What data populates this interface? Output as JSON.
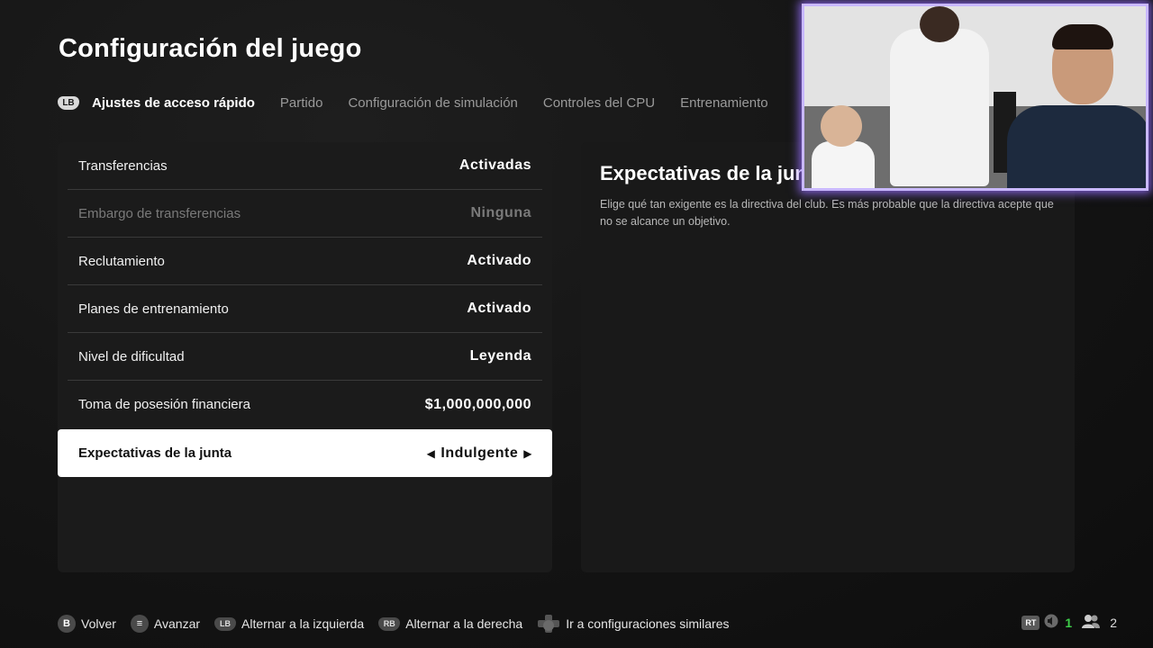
{
  "header": {
    "title": "Configuración del juego"
  },
  "tabs": {
    "prev_button": "LB",
    "items": [
      {
        "label": "Ajustes de acceso rápido"
      },
      {
        "label": "Partido"
      },
      {
        "label": "Configuración de simulación"
      },
      {
        "label": "Controles del CPU"
      },
      {
        "label": "Entrenamiento"
      }
    ]
  },
  "settings": [
    {
      "label": "Transferencias",
      "value": "Activadas"
    },
    {
      "label": "Embargo de transferencias",
      "value": "Ninguna"
    },
    {
      "label": "Reclutamiento",
      "value": "Activado"
    },
    {
      "label": "Planes de entrenamiento",
      "value": "Activado"
    },
    {
      "label": "Nivel de dificultad",
      "value": "Leyenda"
    },
    {
      "label": "Toma de posesión financiera",
      "value": "$1,000,000,000"
    },
    {
      "label": "Expectativas de la junta",
      "value": "Indulgente"
    }
  ],
  "detail": {
    "title": "Expectativas de la junta",
    "description": "Elige qué tan exigente es la directiva del club. Es más probable que la directiva acepte que no se alcance un objetivo."
  },
  "footer": {
    "back": {
      "key": "B",
      "label": "Volver"
    },
    "advance": {
      "key": "≡",
      "label": "Avanzar"
    },
    "left": {
      "key": "LB",
      "label": "Alternar a la izquierda"
    },
    "right": {
      "key": "RB",
      "label": "Alternar a la derecha"
    },
    "similar": {
      "key": "R",
      "label": "Ir a configuraciones similares"
    }
  },
  "status": {
    "rt": "RT",
    "count_green": "1",
    "players": "2"
  },
  "colors": {
    "accent_green": "#3ecf4a",
    "cam_glow": "#c9b8ff"
  }
}
